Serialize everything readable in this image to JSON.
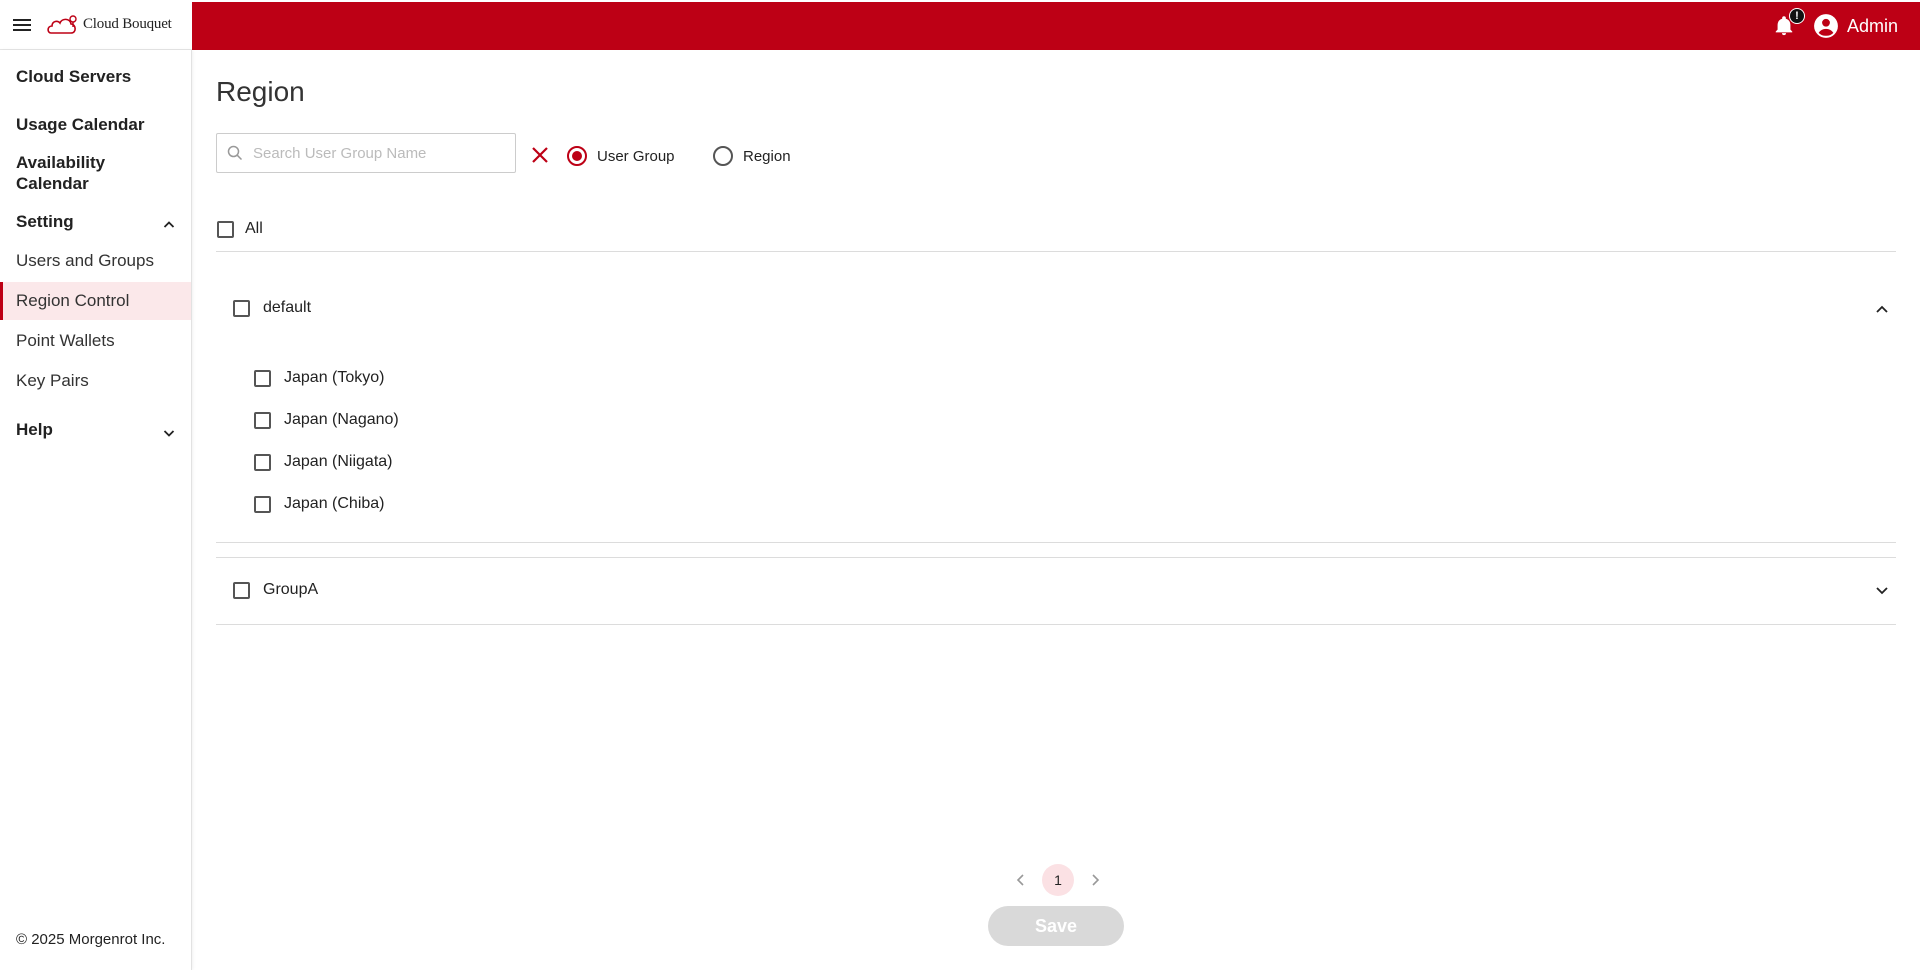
{
  "brand": {
    "name": "Cloud Bouquet",
    "accent": "#bd0015"
  },
  "header": {
    "notification_badge": "!",
    "user_name": "Admin"
  },
  "sidebar": {
    "items": [
      {
        "label": "Cloud Servers"
      },
      {
        "label": "Usage Calendar"
      },
      {
        "label": "Availability Calendar"
      },
      {
        "label": "Setting"
      },
      {
        "label": "Users and Groups"
      },
      {
        "label": "Region Control"
      },
      {
        "label": "Point Wallets"
      },
      {
        "label": "Key Pairs"
      },
      {
        "label": "Help"
      }
    ],
    "footer": "© 2025 Morgenrot Inc."
  },
  "main": {
    "title": "Region",
    "search": {
      "placeholder": "Search User Group Name",
      "value": ""
    },
    "view_modes": [
      {
        "label": "User Group",
        "selected": true
      },
      {
        "label": "Region",
        "selected": false
      }
    ],
    "select_all_label": "All",
    "groups": [
      {
        "name": "default",
        "expanded": true,
        "regions": [
          "Japan (Tokyo)",
          "Japan (Nagano)",
          "Japan (Niigata)",
          "Japan (Chiba)"
        ]
      },
      {
        "name": "GroupA",
        "expanded": false,
        "regions": []
      }
    ],
    "pagination": {
      "current_page": "1"
    },
    "save_label": "Save"
  }
}
